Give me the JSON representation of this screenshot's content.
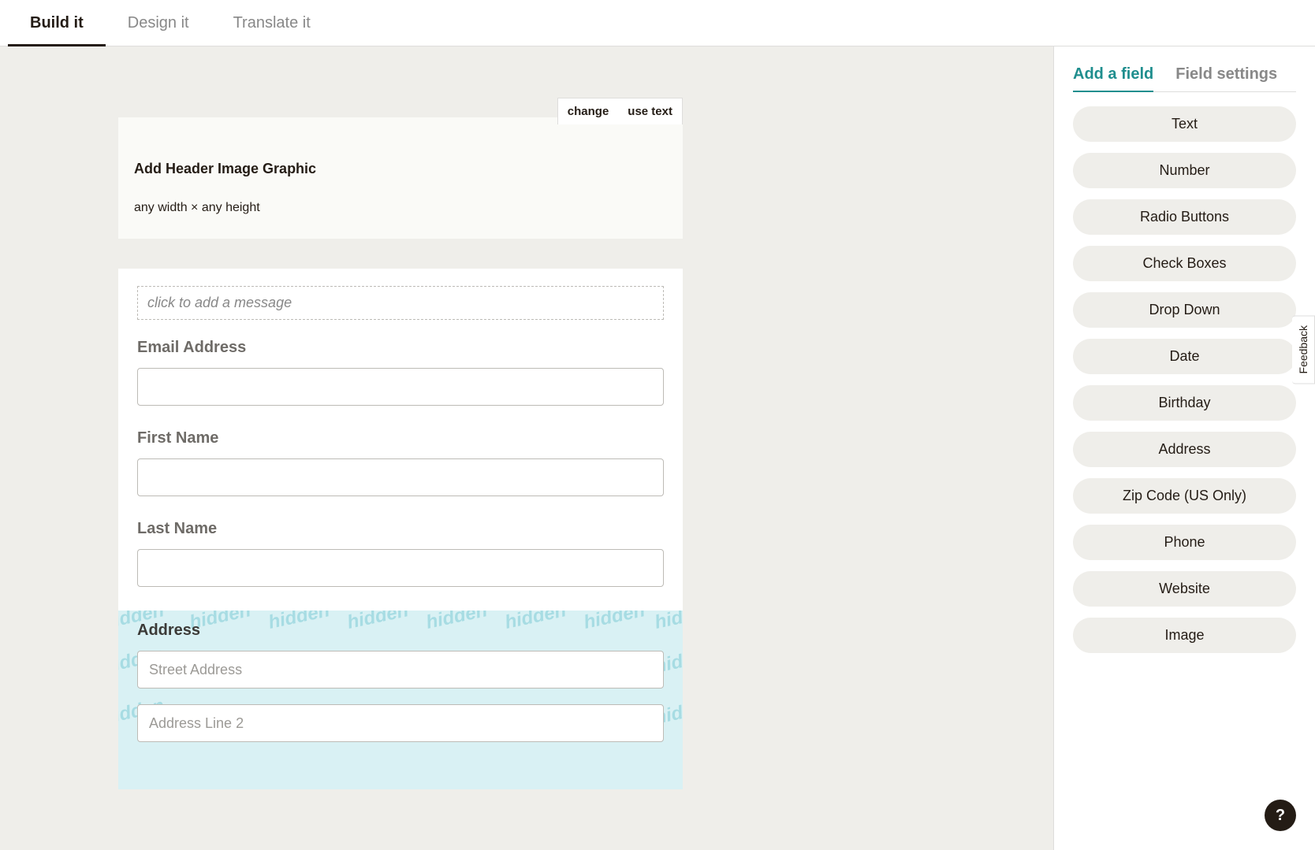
{
  "top_tabs": {
    "build": "Build it",
    "design": "Design it",
    "translate": "Translate it"
  },
  "header_block": {
    "change_label": "change",
    "use_text_label": "use text",
    "title": "Add Header Image Graphic",
    "dims": "any width × any height"
  },
  "form": {
    "message_placeholder": "click to add a message",
    "fields": {
      "email_label": "Email Address",
      "first_name_label": "First Name",
      "last_name_label": "Last Name",
      "address_label": "Address",
      "street_placeholder": "Street Address",
      "line2_placeholder": "Address Line 2"
    },
    "hidden_word": "hidden"
  },
  "sidebar": {
    "tabs": {
      "add": "Add a field",
      "settings": "Field settings"
    },
    "field_types": {
      "text": "Text",
      "number": "Number",
      "radio": "Radio Buttons",
      "check": "Check Boxes",
      "dropdown": "Drop Down",
      "date": "Date",
      "birthday": "Birthday",
      "address": "Address",
      "zip": "Zip Code (US Only)",
      "phone": "Phone",
      "website": "Website",
      "image": "Image"
    }
  },
  "feedback_label": "Feedback",
  "help_label": "?"
}
